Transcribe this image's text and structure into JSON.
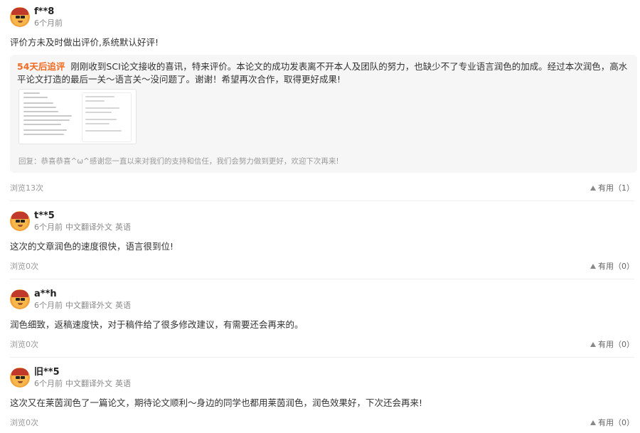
{
  "reviews": [
    {
      "username": "f**8",
      "time": "6个月前",
      "content": "评价方未及时做出评价,系统默认好评!",
      "followup": {
        "tag": "54天后追评",
        "text": "刚刚收到SCI论文接收的喜讯，特来评价。本论文的成功发表离不开本人及团队的努力，也缺少不了专业语言润色的加成。经过本次润色，高水平论文打造的最后一关～语言关～没问题了。谢谢！希望再次合作，取得更好成果!",
        "reply": "回复：恭喜恭喜^ω^感谢您一直以来对我们的支持和信任，我们会努力做到更好，欢迎下次再来!"
      },
      "views": "浏览13次",
      "useful": "有用（1）"
    },
    {
      "username": "t**5",
      "time": "6个月前",
      "service": "中文翻译外文",
      "language": "英语",
      "content": "这次的文章润色的速度很快，语言很到位!",
      "views": "浏览0次",
      "useful": "有用（0）"
    },
    {
      "username": "a**h",
      "time": "6个月前",
      "service": "中文翻译外文",
      "language": "英语",
      "content": "润色细致，返稿速度快，对于稿件给了很多修改建议，有需要还会再来的。",
      "views": "浏览0次",
      "useful": "有用（0）"
    },
    {
      "username": "旧**5",
      "time": "6个月前",
      "service": "中文翻译外文",
      "language": "英语",
      "content": "这次又在莱茵润色了一篇论文，期待论文顺利～身边的同学也都用莱茵润色，润色效果好，下次还会再来!",
      "views": "浏览0次",
      "useful": "有用（0）"
    }
  ]
}
